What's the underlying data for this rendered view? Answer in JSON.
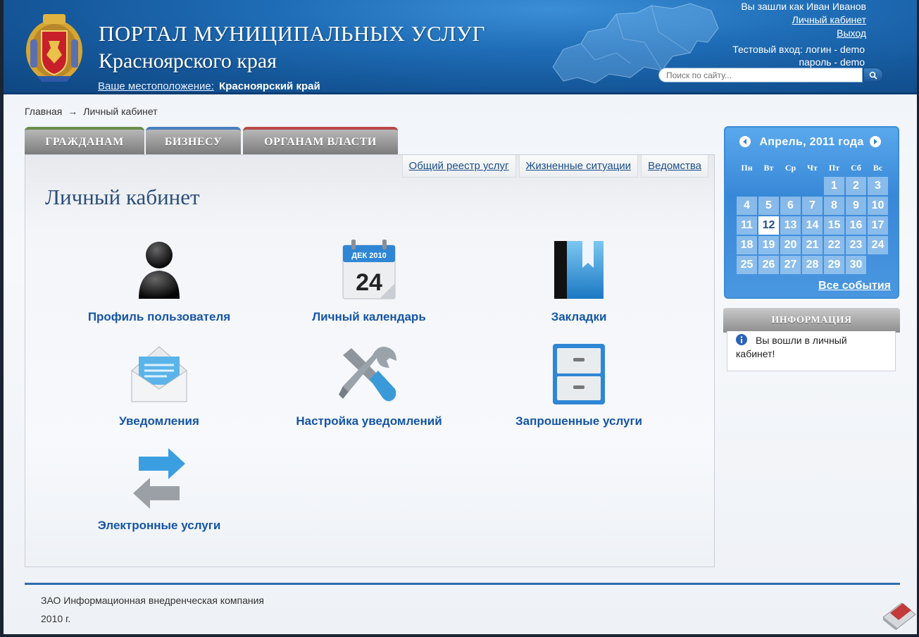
{
  "header": {
    "title": "ПОРТАЛ МУНИЦИПАЛЬНЫХ УСЛУГ",
    "subtitle": "Красноярского края",
    "location_label": "Ваше местоположение:",
    "location_value": "Красноярский край",
    "logged_in_text": "Вы зашли как Иван Иванов",
    "cabinet_link": "Личный кабинет",
    "logout_link": "Выход",
    "test_login": "Тестовый вход: логин - demo",
    "test_password": "пароль - demo",
    "search_placeholder": "Поиск по сайту...",
    "colors": {
      "header_blue": "#1f6db7",
      "accent": "#1555a5"
    }
  },
  "breadcrumb": {
    "home": "Главная",
    "separator": "→",
    "current": "Личный кабинет"
  },
  "tabs": [
    {
      "label": "ГРАЖДАНАМ"
    },
    {
      "label": "БИЗНЕСУ"
    },
    {
      "label": "ОРГАНАМ ВЛАСТИ"
    }
  ],
  "subnav": [
    {
      "label": "Общий реестр услуг"
    },
    {
      "label": "Жизненные ситуации"
    },
    {
      "label": "Ведомства"
    }
  ],
  "main": {
    "title": "Личный кабинет",
    "tiles": [
      {
        "label": "Профиль пользователя",
        "icon": "user-icon"
      },
      {
        "label": "Личный календарь",
        "icon": "calendar-icon",
        "icon_month": "ДЕК 2010",
        "icon_day": "24"
      },
      {
        "label": "Закладки",
        "icon": "bookmark-icon"
      },
      {
        "label": "Уведомления",
        "icon": "envelope-icon"
      },
      {
        "label": "Настройка уведомлений",
        "icon": "tools-icon"
      },
      {
        "label": "Запрошенные услуги",
        "icon": "cabinet-icon"
      },
      {
        "label": "Электронные услуги",
        "icon": "exchange-arrows-icon"
      }
    ]
  },
  "calendar": {
    "title": "Апрель, 2011 года",
    "weekdays": [
      "Пн",
      "Вт",
      "Ср",
      "Чт",
      "Пт",
      "Сб",
      "Вс"
    ],
    "days": [
      "",
      "",
      "",
      "",
      "1",
      "2",
      "3",
      "4",
      "5",
      "6",
      "7",
      "8",
      "9",
      "10",
      "11",
      "12",
      "13",
      "14",
      "15",
      "16",
      "17",
      "18",
      "19",
      "20",
      "21",
      "22",
      "23",
      "24",
      "25",
      "26",
      "27",
      "28",
      "29",
      "30"
    ],
    "today": "12",
    "all_events": "Все события"
  },
  "info": {
    "title": "ИНФОРМАЦИЯ",
    "message": "Вы вошли в личный кабинет!"
  },
  "footer": {
    "company": "ЗАО Информационная внедренческая компания",
    "year": "2010 г."
  }
}
